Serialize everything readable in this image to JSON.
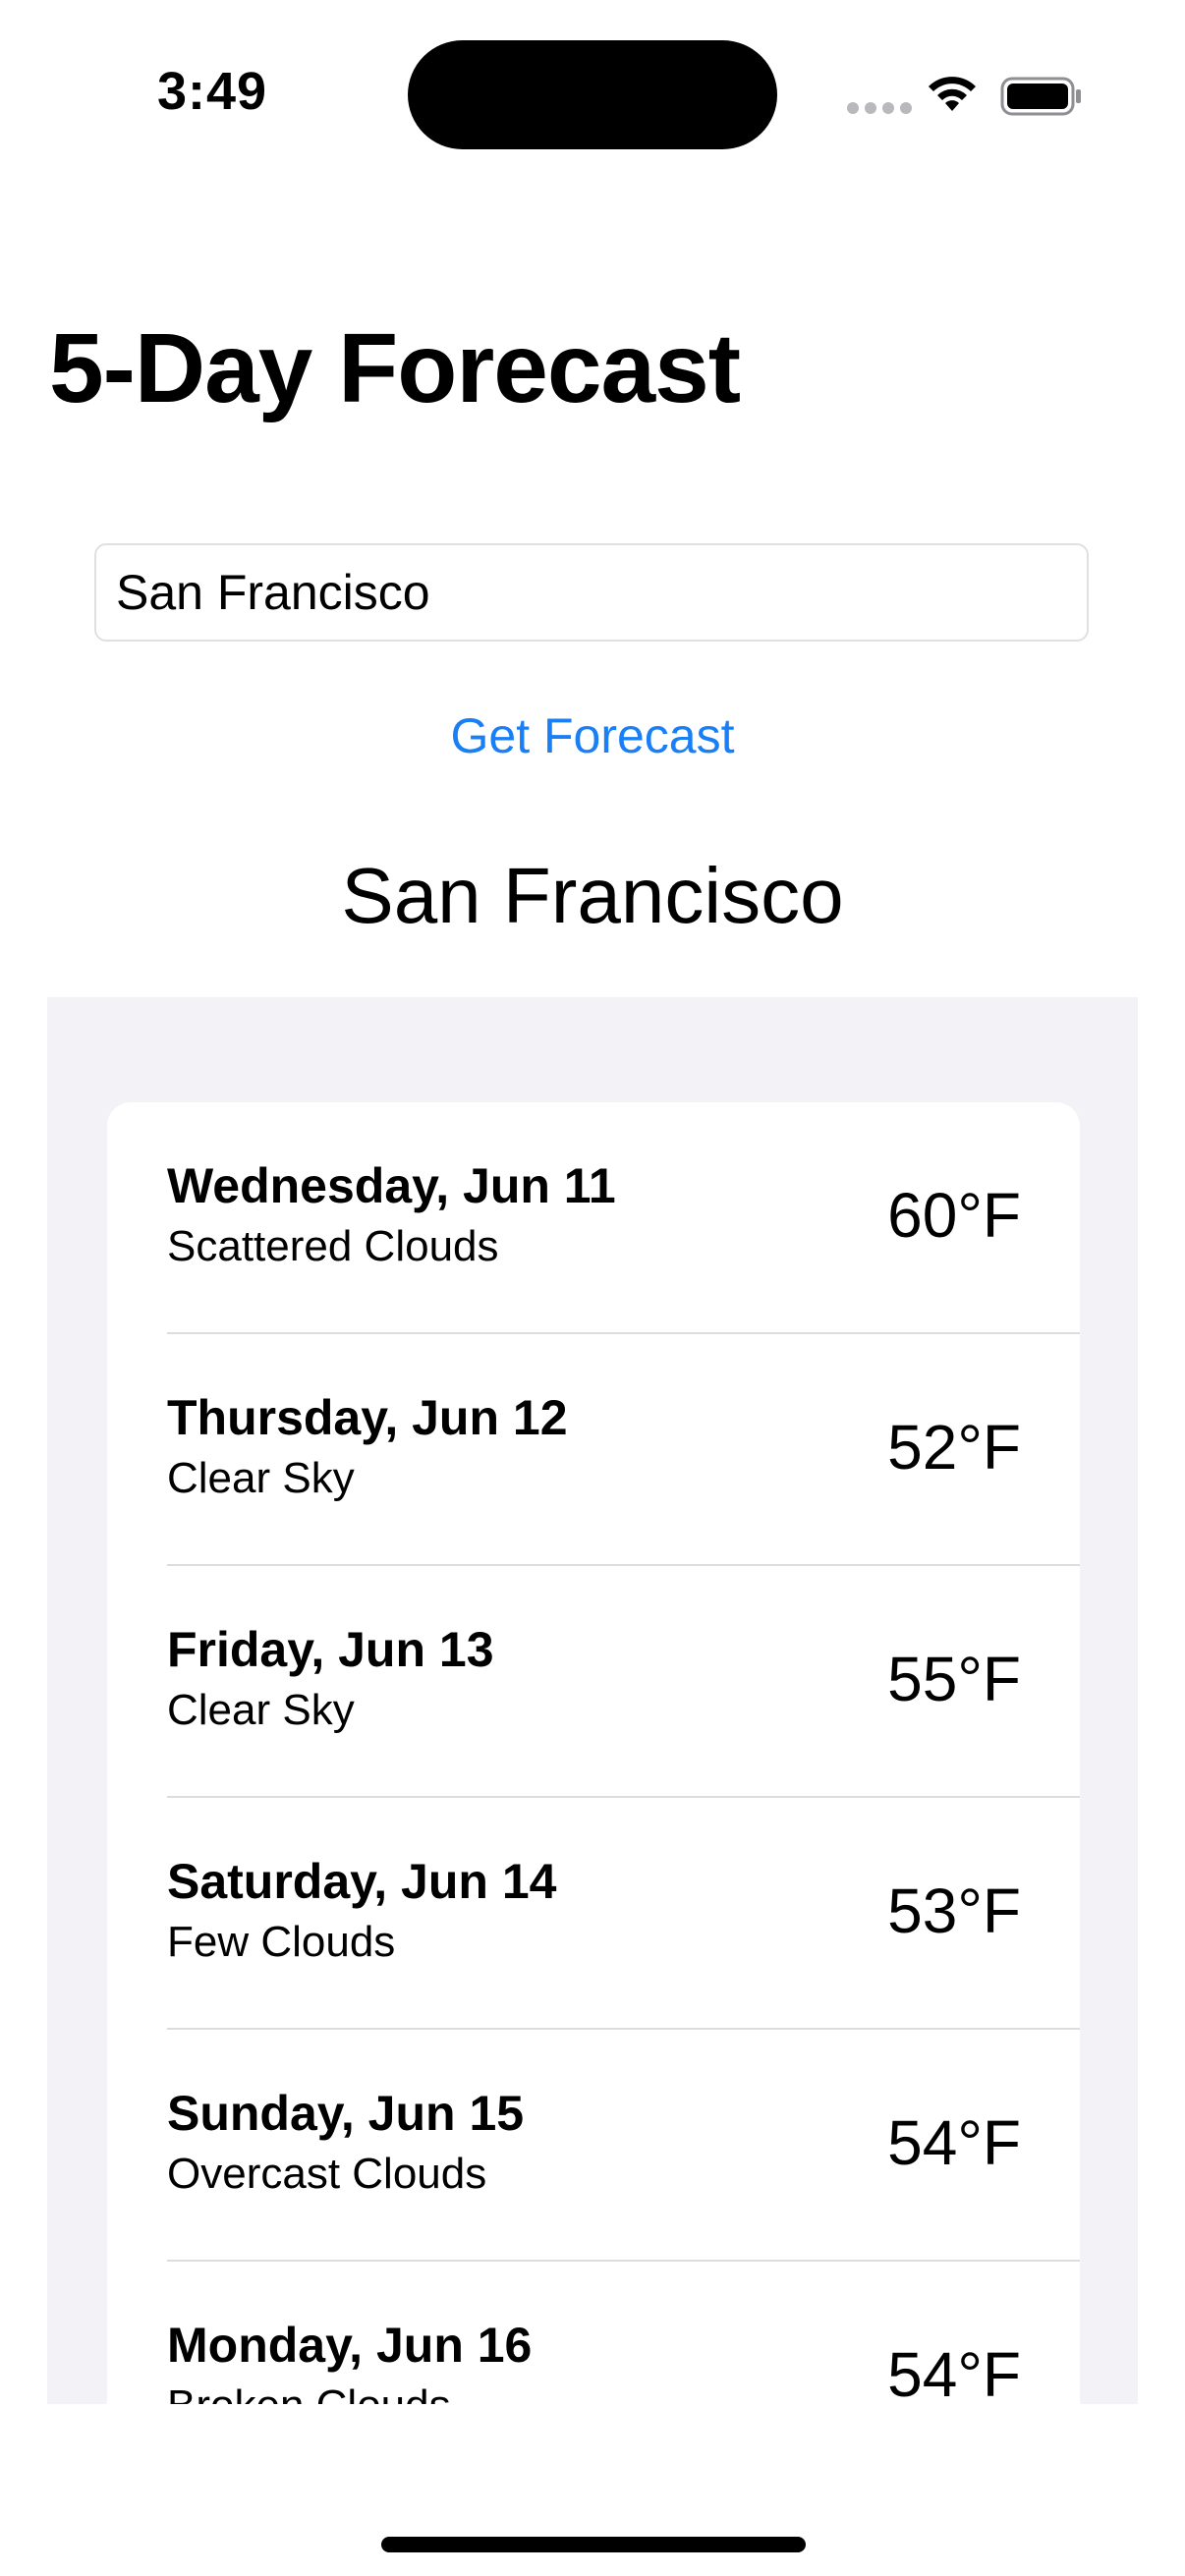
{
  "status_bar": {
    "time": "3:49",
    "icons": [
      "cellular-dots-icon",
      "wifi-icon",
      "battery-icon"
    ]
  },
  "title": "5-Day Forecast",
  "search": {
    "value": "San Francisco",
    "button_label": "Get Forecast"
  },
  "city_heading": "San Francisco",
  "forecast": [
    {
      "date": "Wednesday, Jun 11",
      "condition": "Scattered Clouds",
      "temp": "60°F"
    },
    {
      "date": "Thursday, Jun 12",
      "condition": "Clear Sky",
      "temp": "52°F"
    },
    {
      "date": "Friday, Jun 13",
      "condition": "Clear Sky",
      "temp": "55°F"
    },
    {
      "date": "Saturday, Jun 14",
      "condition": "Few Clouds",
      "temp": "53°F"
    },
    {
      "date": "Sunday, Jun 15",
      "condition": "Overcast Clouds",
      "temp": "54°F"
    },
    {
      "date": "Monday, Jun 16",
      "condition": "Broken Clouds",
      "temp": "54°F"
    }
  ],
  "colors": {
    "accent": "#1a7ff5",
    "list_background": "#f2f2f7",
    "separator": "#dcdce0"
  }
}
